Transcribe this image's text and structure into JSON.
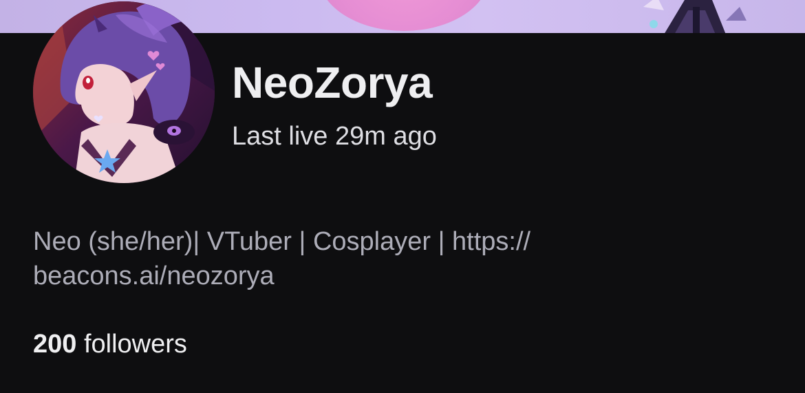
{
  "profile": {
    "channel_name": "NeoZorya",
    "last_live": "Last live 29m ago",
    "bio_lines": [
      "Neo (she/her)| VTuber | Cosplayer | https://",
      "beacons.ai/neozorya"
    ],
    "followers_count": "200",
    "followers_label": "followers"
  },
  "icons": {
    "avatar": "avatar-image",
    "banner": "banner-image"
  },
  "colors": {
    "background": "#0e0e10",
    "name_text": "#efeff1",
    "secondary_text": "#adadb8",
    "banner_base": "#c9b8ec",
    "banner_accent": "#e98fd4"
  }
}
